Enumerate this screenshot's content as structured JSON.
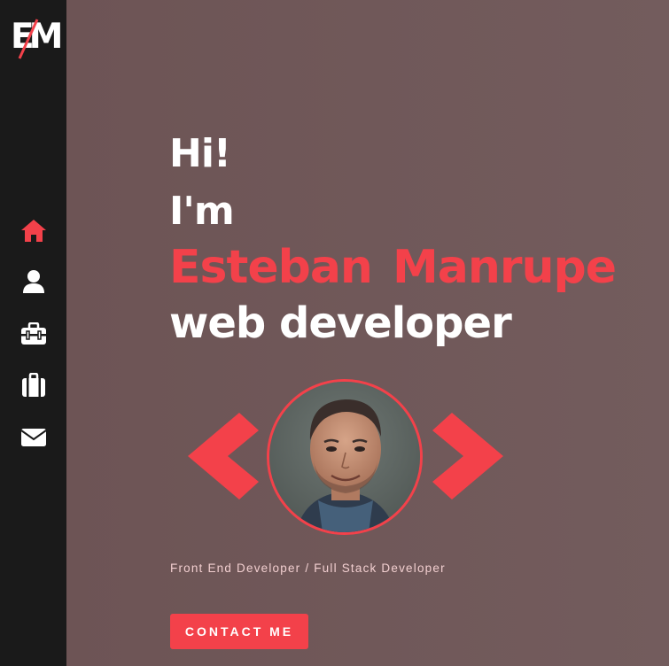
{
  "brand": {
    "logo_text": "EM"
  },
  "sidebar": {
    "items": [
      {
        "icon": "home-icon",
        "active": true
      },
      {
        "icon": "user-icon",
        "active": false
      },
      {
        "icon": "toolbox-icon",
        "active": false
      },
      {
        "icon": "suitcase-icon",
        "active": false
      },
      {
        "icon": "envelope-icon",
        "active": false
      }
    ]
  },
  "hero": {
    "greeting": "Hi!",
    "intro": "I'm",
    "name": "Esteban Manrupe",
    "role": "web developer",
    "subtitle": "Front End Developer / Full Stack Developer",
    "cta_label": "CONTACT ME"
  },
  "colors": {
    "accent": "#f3414a",
    "sidebar_bg": "#1a1a1a",
    "main_bg": "#6d5556",
    "nav_icon": "#ffffff"
  }
}
